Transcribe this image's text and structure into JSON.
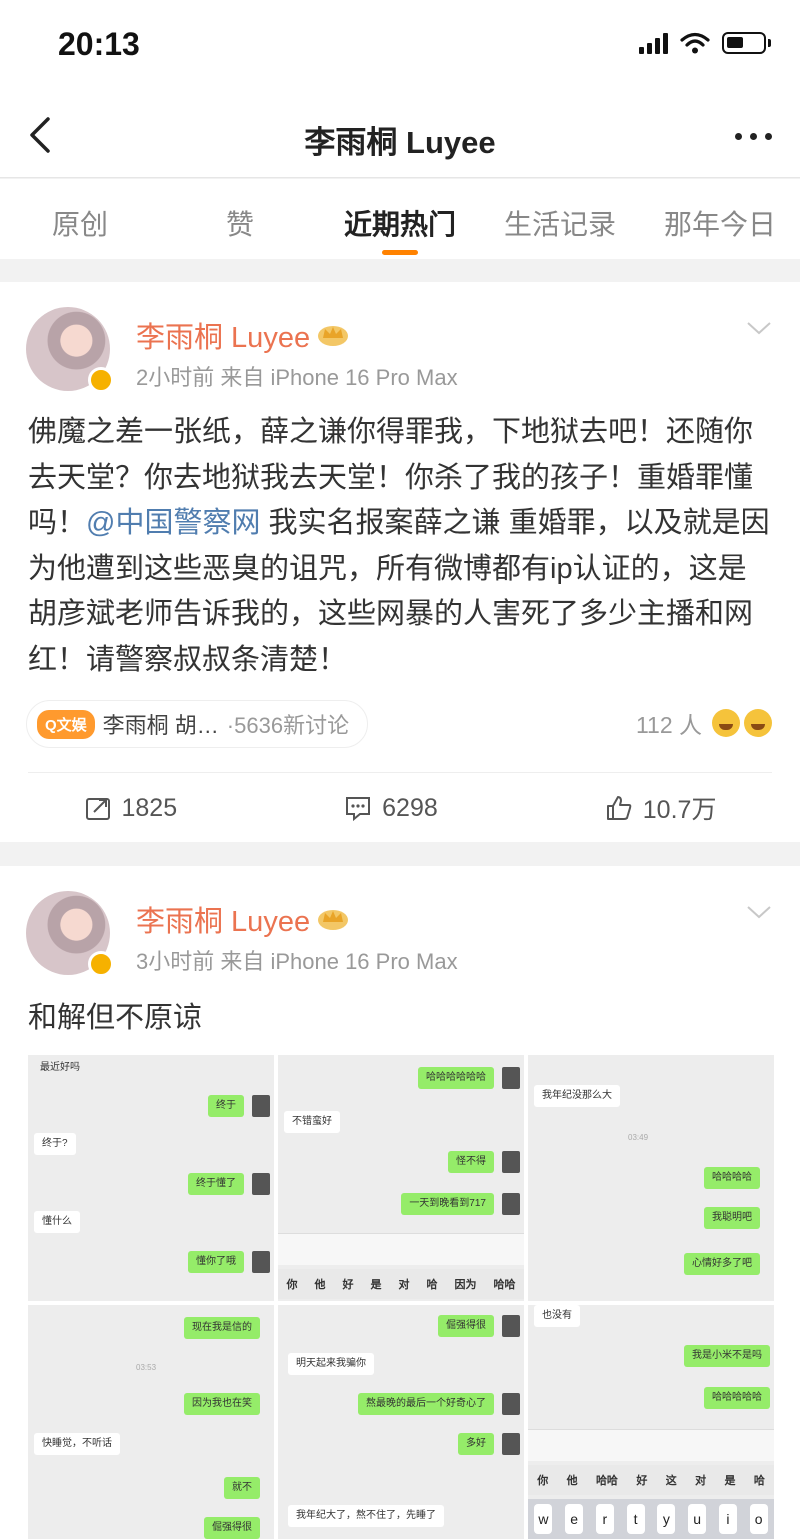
{
  "status": {
    "time": "20:13"
  },
  "nav": {
    "title": "李雨桐 Luyee"
  },
  "tabs": [
    "原创",
    "赞",
    "近期热门",
    "生活记录",
    "那年今日"
  ],
  "posts": [
    {
      "username": "李雨桐 Luyee",
      "meta": "2小时前  来自 iPhone 16 Pro Max",
      "text_before": "佛魔之差一张纸，薛之谦你得罪我，下地狱去吧！还随你去天堂？你去地狱我去天堂！你杀了我的孩子！重婚罪懂吗！",
      "mention": "@中国警察网",
      "text_after": " 我实名报案薛之谦 重婚罪，以及就是因为他遭到这些恶臭的诅咒，所有微博都有ip认证的，这是胡彦斌老师告诉我的，这些网暴的人害死了多少主播和网红！请警察叔叔条清楚！",
      "topic_tag": "Q文娱",
      "topic_text": "李雨桐 胡…",
      "topic_sub": "·5636新讨论",
      "reactions": "112 人",
      "reposts": "1825",
      "comments": "6298",
      "likes": "10.7万"
    },
    {
      "username": "李雨桐 Luyee",
      "meta": "3小时前  来自 iPhone 16 Pro Max",
      "text": "和解但不原谅"
    }
  ],
  "chat": {
    "s1": [
      "最近好吗",
      "终于",
      "终于?",
      "终于懂了",
      "懂什么",
      "懂你了哦"
    ],
    "s2": [
      "哈哈哈哈哈哈",
      "不错蛮好",
      "怪不得",
      "一天到晚看到717"
    ],
    "s2_cands": [
      "你",
      "他",
      "好",
      "是",
      "对",
      "哈",
      "因为",
      "哈哈"
    ],
    "s3": [
      "我年纪没那么大",
      "03:49",
      "哈哈哈哈",
      "我聪明吧",
      "心情好多了吧"
    ],
    "s4": [
      "现在我是信的",
      "03:53",
      "因为我也在笑",
      "快睡觉，不听话",
      "就不",
      "倔强得很"
    ],
    "s5": [
      "倔强得很",
      "明天起来我骗你",
      "熬最晚的最后一个好奇心了",
      "多好",
      "我年纪大了，熬不住了，先睡了"
    ],
    "s6": [
      "也没有",
      "我是小米不是吗",
      "哈哈哈哈哈"
    ],
    "s6_cands": [
      "你",
      "他",
      "哈哈",
      "好",
      "这",
      "对",
      "是",
      "哈"
    ],
    "s6_keys": [
      "w",
      "e",
      "r",
      "t",
      "y",
      "u",
      "i",
      "o"
    ]
  }
}
